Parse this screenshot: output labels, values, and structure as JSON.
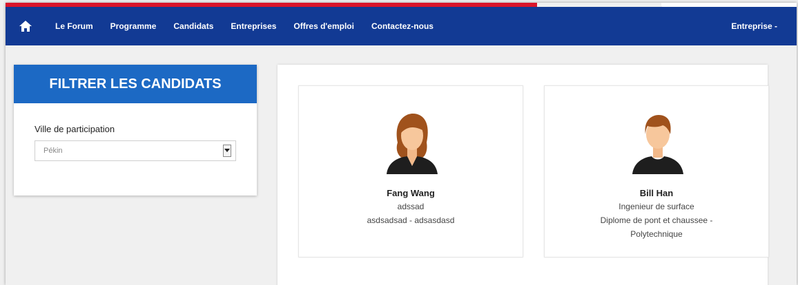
{
  "nav": {
    "links": [
      "Le Forum",
      "Programme",
      "Candidats",
      "Entreprises",
      "Offres d'emploi",
      "Contactez-nous"
    ],
    "right_label": "Entreprise -",
    "home_icon": "home-icon"
  },
  "filter": {
    "title": "FILTRER LES CANDIDATS",
    "label": "Ville de participation",
    "selected": "Pékin"
  },
  "candidates": [
    {
      "name": "Fang Wang",
      "line1": "adssad",
      "line2": "asdsadsad - adsasdasd",
      "line3": "",
      "avatar": "female-avatar-icon"
    },
    {
      "name": "Bill Han",
      "line1": "Ingenieur de surface",
      "line2": "Diplome de pont et chaussee -",
      "line3": "Polytechnique",
      "avatar": "male-avatar-icon"
    }
  ],
  "colors": {
    "navbar": "#123a94",
    "accent": "#d9152b",
    "filter_header": "#1c69c4"
  }
}
